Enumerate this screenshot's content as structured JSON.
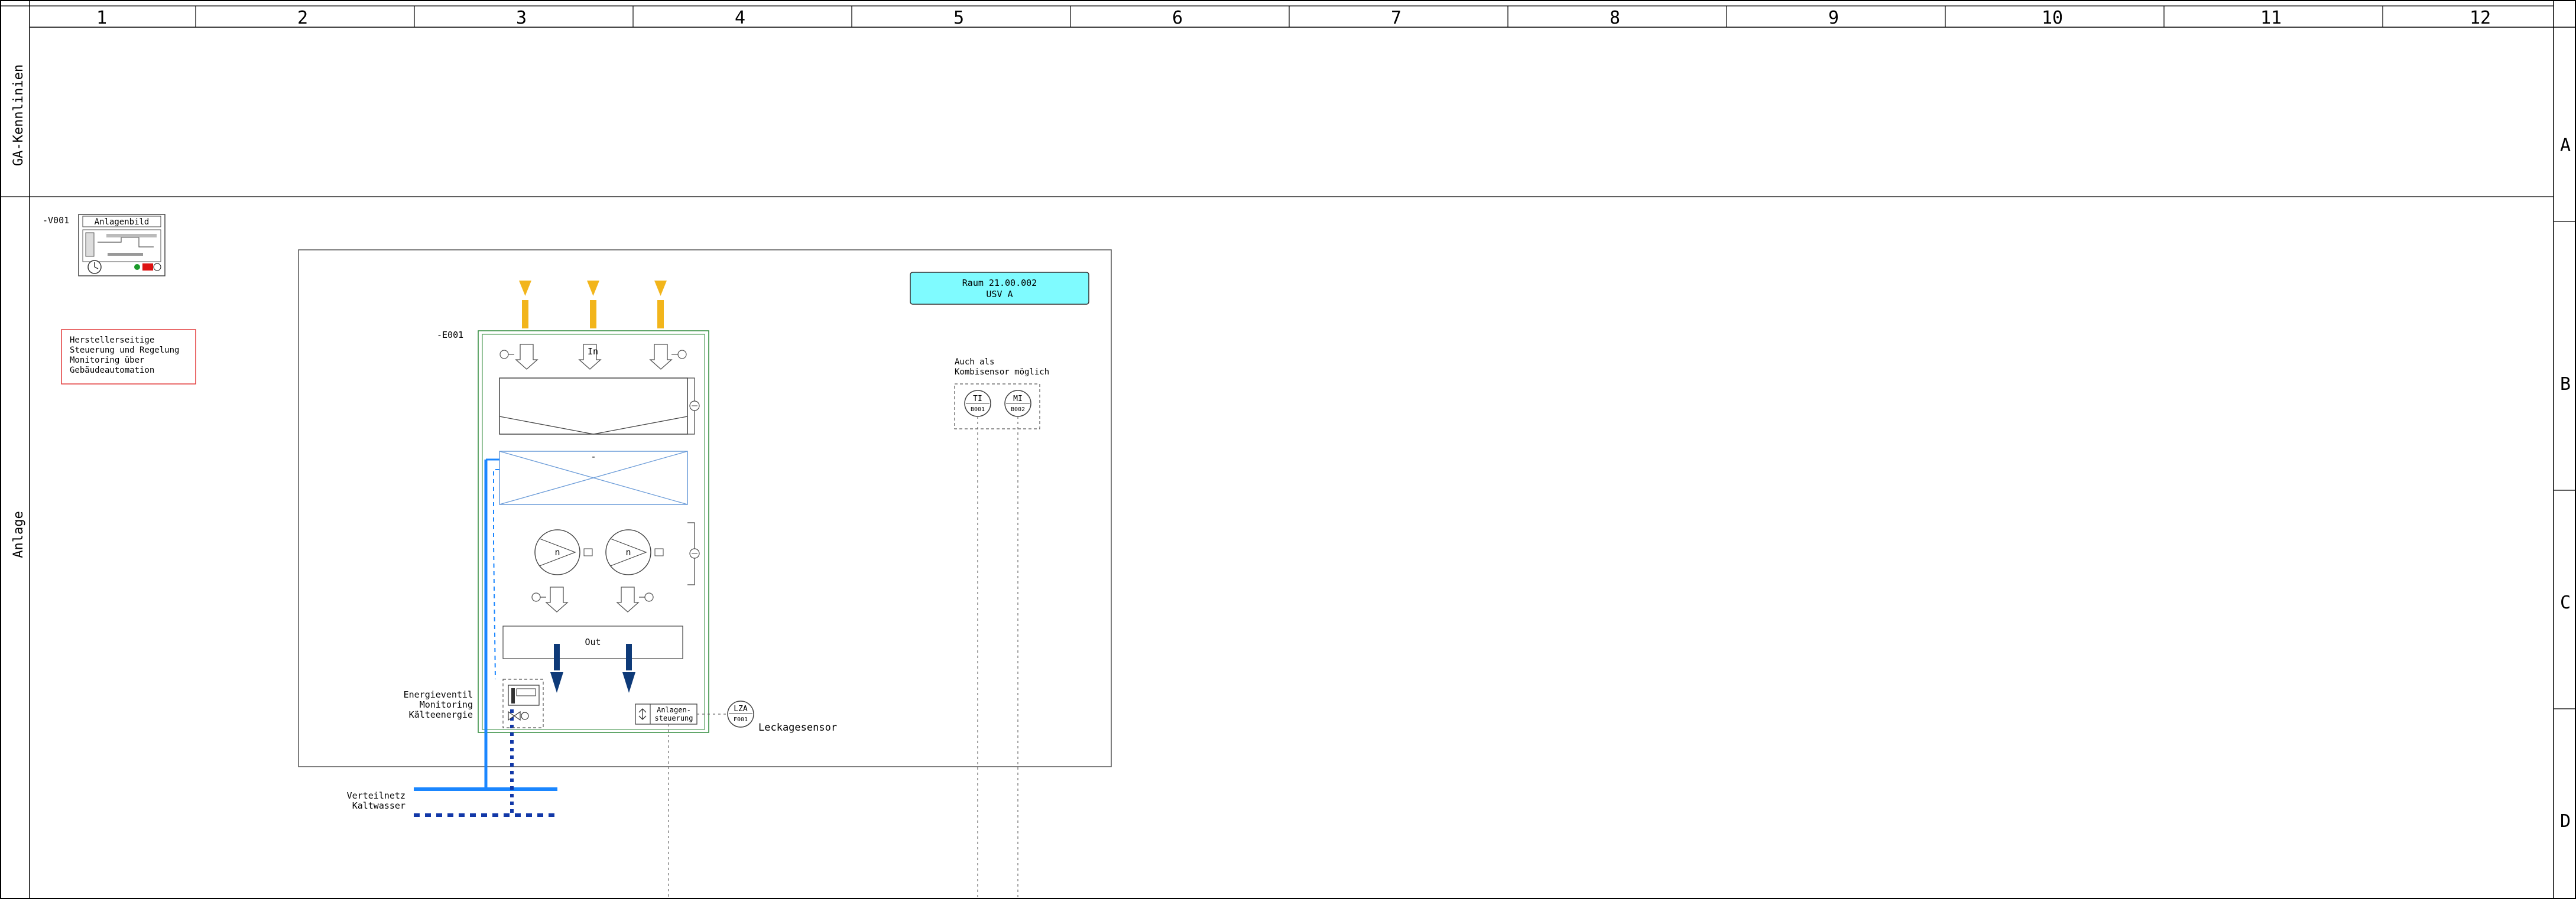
{
  "columns": [
    "1",
    "2",
    "3",
    "4",
    "5",
    "6",
    "7",
    "8",
    "9",
    "10",
    "11",
    "12"
  ],
  "rows": [
    "A",
    "B",
    "C",
    "D"
  ],
  "side_labels": {
    "top": "GA-Kennlinien",
    "bottom": "Anlage"
  },
  "v001": {
    "tag": "-V001",
    "title": "Anlagenbild"
  },
  "note": {
    "lines": [
      "Herstellerseitige",
      "Steuerung und Regelung",
      "Monitoring über",
      "Gebäudeautomation"
    ]
  },
  "unit": {
    "tag": "-E001",
    "inlet_label": "In",
    "outlet_label": "Out",
    "fan_label": "n",
    "coil_mark": "-"
  },
  "room": {
    "line1": "Raum 21.00.002",
    "line2": "USV A"
  },
  "combi": {
    "line1": "Auch als",
    "line2": "Kombisensor möglich"
  },
  "sensors": [
    {
      "code": "TI",
      "id": "B001"
    },
    {
      "code": "MI",
      "id": "B002"
    }
  ],
  "leak": {
    "code": "LZA",
    "id": "F001",
    "label": "Leckagesensor"
  },
  "control": {
    "line1": "Anlagen-",
    "line2": "steuerung"
  },
  "energy_valve": {
    "lines": [
      "Energieventil",
      "Monitoring",
      "Kälteenergie"
    ]
  },
  "network": {
    "lines": [
      "Verteilnetz",
      "Kaltwasser"
    ]
  },
  "colors": {
    "accent_room": "#7ffbff",
    "supply_pipe": "#1a86ff",
    "return_pipe": "#1238a8",
    "air_arrow": "#f2b51b",
    "dark_arrow": "#0e3a78",
    "coil_lines": "#6a9bd8",
    "enclosure": "#2f8a3a",
    "note_border": "#e23a3a"
  }
}
